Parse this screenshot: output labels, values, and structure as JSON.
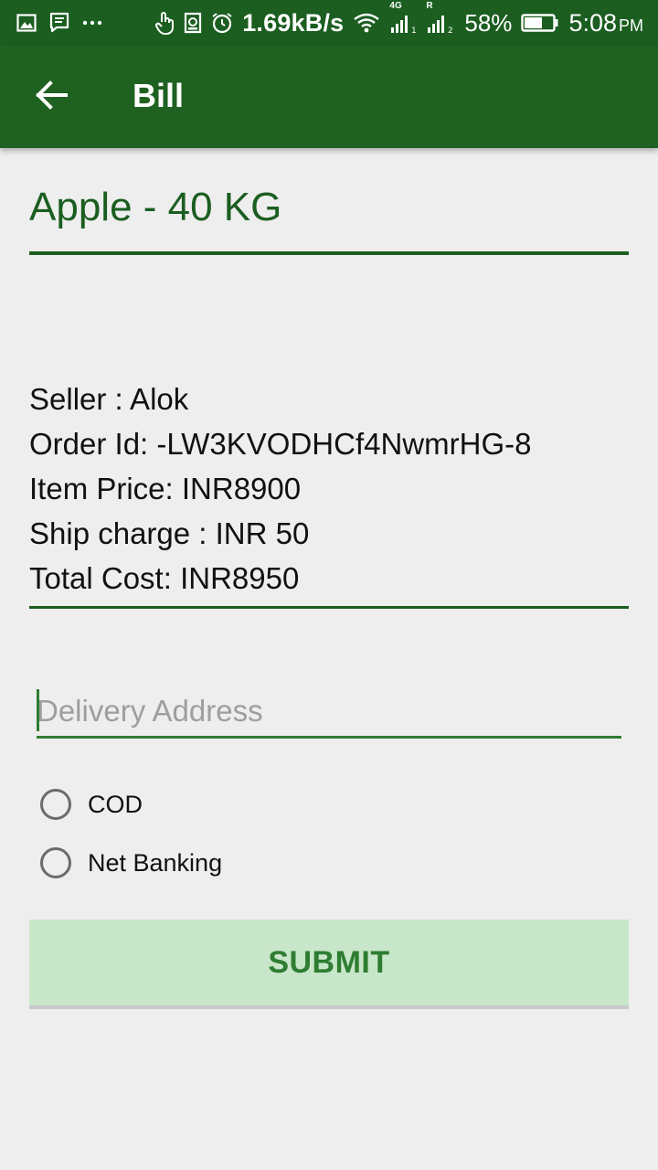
{
  "colors": {
    "primary": "#1b5e20",
    "accent": "#2e7d32",
    "button_bg": "#c8e6c9",
    "background": "#eeeeee"
  },
  "status_bar": {
    "speed": "1.69kB/s",
    "network_4g": "4G",
    "roaming": "R",
    "battery": "58%",
    "time": "5:08",
    "ampm": "PM",
    "icons": [
      "image-icon",
      "message-icon",
      "more-icon",
      "touch-icon",
      "sd-card-icon",
      "alarm-icon",
      "wifi-icon",
      "signal-icon",
      "battery-icon"
    ]
  },
  "app_bar": {
    "title": "Bill",
    "back_icon": "arrow-back-icon"
  },
  "product": {
    "title": "Apple - 40 KG"
  },
  "details": {
    "seller": "Seller : Alok",
    "order_id": "Order Id: -LW3KVODHCf4NwmrHG-8",
    "item_price": "Item Price: INR8900",
    "ship_charge": "Ship charge : INR 50",
    "total_cost": "Total Cost: INR8950"
  },
  "address": {
    "placeholder": "Delivery Address",
    "value": ""
  },
  "payment_options": [
    {
      "label": "COD",
      "selected": false
    },
    {
      "label": "Net Banking",
      "selected": false
    }
  ],
  "submit": {
    "label": "SUBMIT"
  }
}
